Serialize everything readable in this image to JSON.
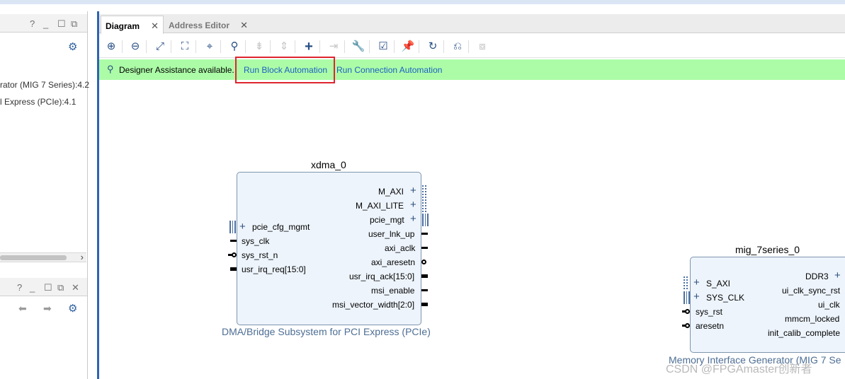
{
  "left_top_panel": {
    "controls": [
      "?",
      "_",
      "☐",
      "⧉"
    ],
    "tree_items": [
      "rator (MIG 7 Series):4.2",
      "l Express (PCIe):4.1"
    ]
  },
  "left_bottom_panel": {
    "controls": [
      "?",
      "_",
      "☐",
      "⧉",
      "✕"
    ]
  },
  "tabs": [
    {
      "label": "Diagram",
      "active": true
    },
    {
      "label": "Address Editor",
      "active": false
    }
  ],
  "close_glyph": "✕",
  "toolbar_icons": [
    "zoom-in-icon",
    "zoom-out-icon",
    "fit-icon",
    "zoom-area-icon",
    "center-icon",
    "search-icon",
    "collapse-icon",
    "expand-icon",
    "add-ip-icon",
    "make-connection-icon",
    "properties-icon",
    "validate-icon",
    "pin-icon",
    "regenerate-icon",
    "optimize-routing-icon",
    "hierarchy-icon"
  ],
  "assist": {
    "message": "Designer Assistance available.",
    "link1": "Run Block Automation",
    "link2": "Run Connection Automation"
  },
  "xdma": {
    "name": "xdma_0",
    "subtitle": "DMA/Bridge Subsystem for PCI Express (PCIe)",
    "right_ports": [
      "M_AXI",
      "M_AXI_LITE",
      "pcie_mgt",
      "user_lnk_up",
      "axi_aclk",
      "axi_aresetn",
      "usr_irq_ack[15:0]",
      "msi_enable",
      "msi_vector_width[2:0]"
    ],
    "left_ports": [
      "pcie_cfg_mgmt",
      "sys_clk",
      "sys_rst_n",
      "usr_irq_req[15:0]"
    ]
  },
  "mig": {
    "name": "mig_7series_0",
    "subtitle": "Memory Interface Generator (MIG 7 Se",
    "left_ports": [
      "S_AXI",
      "SYS_CLK",
      "sys_rst",
      "aresetn"
    ],
    "right_ports": [
      "DDR3",
      "ui_clk_sync_rst",
      "ui_clk",
      "mmcm_locked",
      "init_calib_complete"
    ]
  },
  "watermark": "CSDN @FPGAmaster创新者"
}
